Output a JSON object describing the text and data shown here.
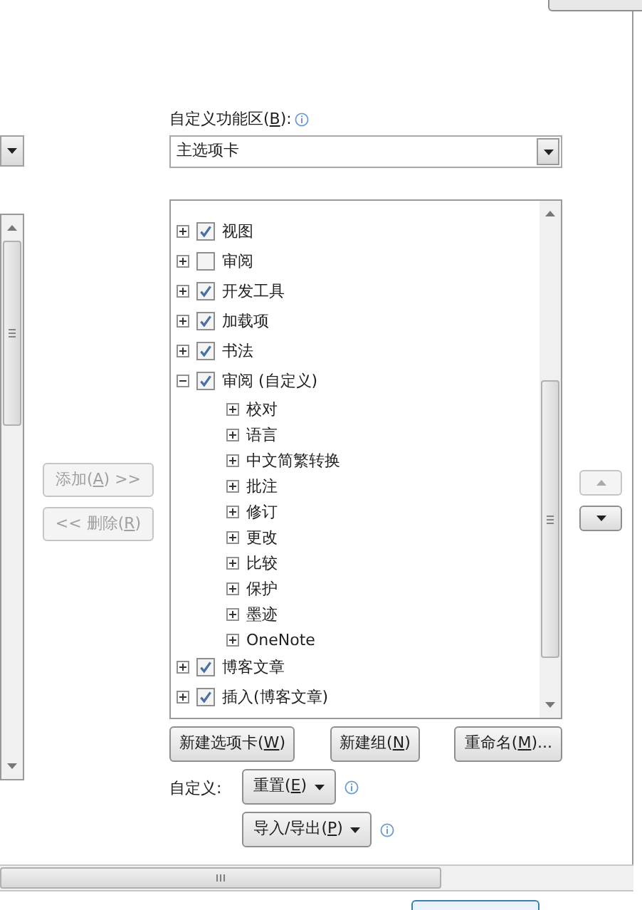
{
  "customize_ribbon": {
    "label_start": "自定义功能区(",
    "access_key": "B",
    "label_end": "):",
    "dropdown_value": "主选项卡"
  },
  "transfer_buttons": [
    {
      "label_start": "添加(",
      "access_key": "A",
      "label_end": ") >>",
      "disabled": true
    },
    {
      "label_start": "<< 删除(",
      "access_key": "R",
      "label_end": ")",
      "disabled": true
    }
  ],
  "tree": [
    {
      "label": "视图",
      "checked": true,
      "expanded": false
    },
    {
      "label": "审阅",
      "checked": false,
      "expanded": false
    },
    {
      "label": "开发工具",
      "checked": true,
      "expanded": false
    },
    {
      "label": "加载项",
      "checked": true,
      "expanded": false
    },
    {
      "label": "书法",
      "checked": true,
      "expanded": false
    },
    {
      "label": "审阅 (自定义)",
      "checked": true,
      "expanded": true,
      "children": [
        {
          "label": "校对",
          "expanded": false
        },
        {
          "label": "语言",
          "expanded": false
        },
        {
          "label": "中文简繁转换",
          "expanded": false
        },
        {
          "label": "批注",
          "expanded": false
        },
        {
          "label": "修订",
          "expanded": false
        },
        {
          "label": "更改",
          "expanded": false
        },
        {
          "label": "比较",
          "expanded": false
        },
        {
          "label": "保护",
          "expanded": false
        },
        {
          "label": "墨迹",
          "expanded": false
        },
        {
          "label": "OneNote",
          "expanded": false
        }
      ]
    },
    {
      "label": "博客文章",
      "checked": true,
      "expanded": false
    },
    {
      "label": "插入(博客文章)",
      "checked": true,
      "expanded": false
    }
  ],
  "move_buttons": [
    {
      "kind": "up",
      "disabled": true
    },
    {
      "kind": "down",
      "disabled": false
    }
  ],
  "action_buttons": [
    {
      "label_start": "新建选项卡(",
      "access_key": "W",
      "label_end": ")"
    },
    {
      "label_start": "新建组(",
      "access_key": "N",
      "label_end": ")"
    },
    {
      "label_start": "重命名(",
      "access_key": "M",
      "label_end": ")..."
    }
  ],
  "customizations": {
    "label": "自定义:",
    "buttons": [
      {
        "label_start": "重置(",
        "access_key": "E",
        "label_end": ")"
      },
      {
        "label_start": "导入/导出(",
        "access_key": "P",
        "label_end": ")"
      }
    ]
  }
}
